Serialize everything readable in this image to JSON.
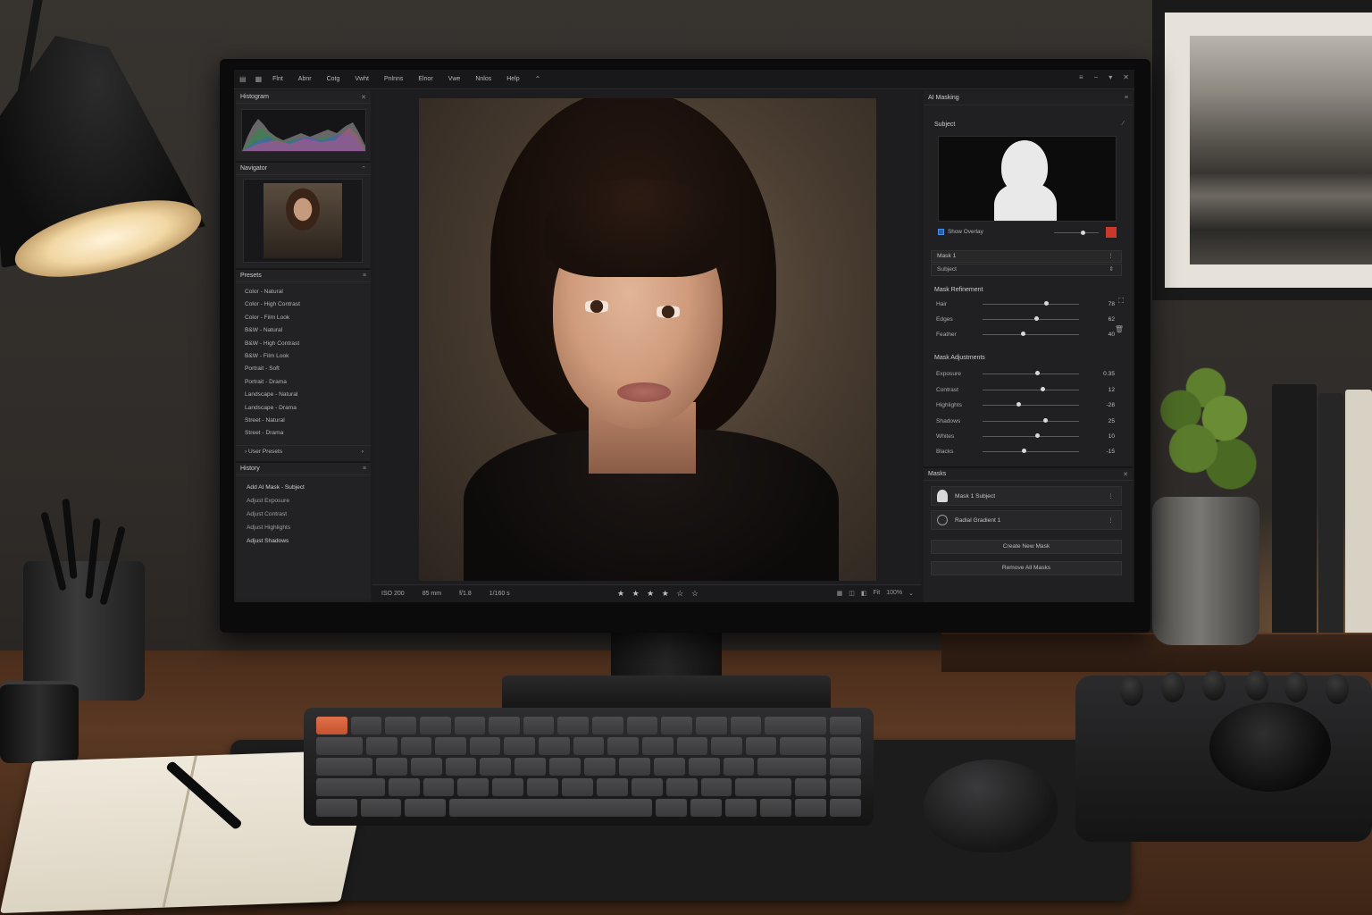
{
  "menubar": {
    "items": [
      "Flnt",
      "Abnr",
      "Cotg",
      "Vwht",
      "Pnlnns",
      "Elnor",
      "Vwe",
      "Nnlos",
      "Help"
    ]
  },
  "left_panel": {
    "histogram": {
      "title": "Histogram"
    },
    "navigator": {
      "title": "Navigator"
    },
    "presets": {
      "title": "Presets",
      "items": [
        "Color - Natural",
        "Color - High Contrast",
        "Color - Film Look",
        "B&W - Natural",
        "B&W - High Contrast",
        "B&W - Film Look",
        "Portrait - Soft",
        "Portrait - Drama",
        "Landscape - Natural",
        "Landscape - Drama",
        "Street - Natural",
        "Street - Drama"
      ],
      "user_presets": "User Presets"
    },
    "history": {
      "title": "History",
      "items": [
        "Add AI Mask - Subject",
        "Adjust Exposure",
        "Adjust Contrast",
        "Adjust Highlights",
        "Adjust Shadows"
      ]
    }
  },
  "statusbar": {
    "iso": "ISO 200",
    "focal": "85 mm",
    "aperture": "f/1.8",
    "shutter": "1/160 s",
    "rating": 4,
    "stars": "★ ★ ★ ★ ☆ ☆",
    "fit": "Fit",
    "zoom": "100%"
  },
  "right_panel": {
    "ai_masking": {
      "title": "AI Masking",
      "subject_label": "Subject",
      "show_overlay": "Show Overlay",
      "overlay_color": "#c8392b"
    },
    "mask_select": {
      "name": "Mask 1",
      "type": "Subject"
    },
    "refinement": {
      "title": "Mask Refinement",
      "sliders": [
        {
          "label": "Hair",
          "value": "78",
          "pos": 0.64
        },
        {
          "label": "Edges",
          "value": "62",
          "pos": 0.54
        },
        {
          "label": "Feather",
          "value": "40",
          "pos": 0.4
        }
      ]
    },
    "adjustments": {
      "title": "Mask Adjustments",
      "sliders": [
        {
          "label": "Exposure",
          "value": "0.35",
          "pos": 0.55
        },
        {
          "label": "Contrast",
          "value": "12",
          "pos": 0.6
        },
        {
          "label": "Highlights",
          "value": "-28",
          "pos": 0.35
        },
        {
          "label": "Shadows",
          "value": "25",
          "pos": 0.63
        },
        {
          "label": "Whites",
          "value": "10",
          "pos": 0.55
        },
        {
          "label": "Blacks",
          "value": "-15",
          "pos": 0.41
        }
      ]
    },
    "masks": {
      "title": "Masks",
      "items": [
        "Mask 1  Subject",
        "Radial Gradient 1"
      ],
      "create": "Create New Mask",
      "remove": "Remove All Masks"
    }
  }
}
